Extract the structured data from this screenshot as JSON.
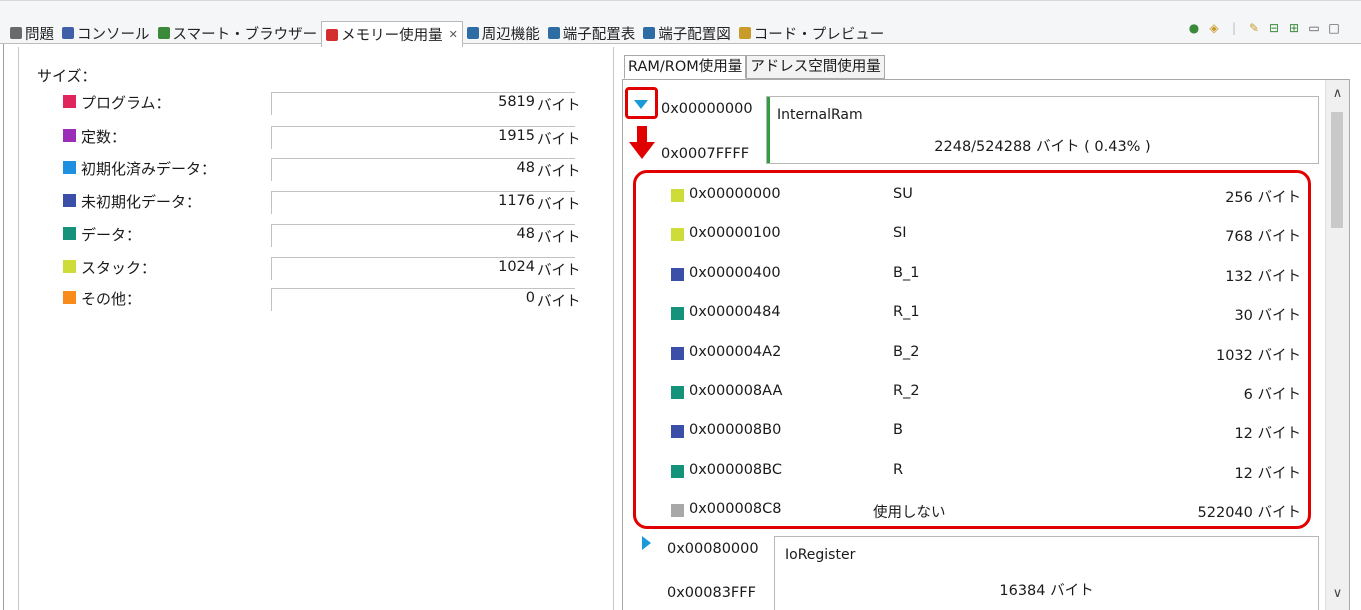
{
  "tabs": [
    {
      "label": "問題",
      "icon": "problems-icon",
      "color": "#6a6a6a"
    },
    {
      "label": "コンソール",
      "icon": "console-icon",
      "color": "#3f5fa8"
    },
    {
      "label": "スマート・ブラウザー",
      "icon": "smart-browser-icon",
      "color": "#3a8a3a"
    },
    {
      "label": "メモリー使用量",
      "icon": "memory-usage-icon",
      "color": "#d32f2f",
      "active": true,
      "close": "✕"
    },
    {
      "label": "周辺機能",
      "icon": "peripheral-icon",
      "color": "#2e6da4"
    },
    {
      "label": "端子配置表",
      "icon": "pin-table-icon",
      "color": "#2e6da4"
    },
    {
      "label": "端子配置図",
      "icon": "pin-diagram-icon",
      "color": "#2e6da4"
    },
    {
      "label": "コード・プレビュー",
      "icon": "code-preview-icon",
      "color": "#c89b2b"
    }
  ],
  "toolbar": {
    "minimize": "▭",
    "maximize": "□"
  },
  "left": {
    "title": "サイズ：",
    "items": [
      {
        "label": "プログラム：",
        "value": "5819",
        "unit": "バイト",
        "color": "#e0255c"
      },
      {
        "label": "定数：",
        "value": "1915",
        "unit": "バイト",
        "color": "#9b2db6"
      },
      {
        "label": "初期化済みデータ：",
        "value": "48",
        "unit": "バイト",
        "color": "#1f8fe0"
      },
      {
        "label": "未初期化データ：",
        "value": "1176",
        "unit": "バイト",
        "color": "#3b4fa8"
      },
      {
        "label": "データ：",
        "value": "48",
        "unit": "バイト",
        "color": "#14927a"
      },
      {
        "label": "スタック：",
        "value": "1024",
        "unit": "バイト",
        "color": "#cddc39"
      },
      {
        "label": "その他：",
        "value": "0",
        "unit": "バイト",
        "color": "#f78c1a"
      }
    ]
  },
  "right": {
    "tabs": [
      {
        "label": "RAM/ROM使用量",
        "active": true
      },
      {
        "label": "アドレス空間使用量",
        "active": false
      }
    ],
    "regions": [
      {
        "start": "0x00000000",
        "end": "0x0007FFFF",
        "name": "InternalRam",
        "usage": "2248/524288 バイト ( 0.43% )",
        "expanded": true
      },
      {
        "start": "0x00080000",
        "end": "0x00083FFF",
        "name": "IoRegister",
        "usage": "16384 バイト",
        "expanded": false
      }
    ],
    "segments": [
      {
        "addr": "0x00000000",
        "name": "SU",
        "size": "256 バイト",
        "color": "#cddc39"
      },
      {
        "addr": "0x00000100",
        "name": "SI",
        "size": "768 バイト",
        "color": "#cddc39"
      },
      {
        "addr": "0x00000400",
        "name": "B_1",
        "size": "132 バイト",
        "color": "#3b4fa8"
      },
      {
        "addr": "0x00000484",
        "name": "R_1",
        "size": "30 バイト",
        "color": "#14927a"
      },
      {
        "addr": "0x000004A2",
        "name": "B_2",
        "size": "1032 バイト",
        "color": "#3b4fa8"
      },
      {
        "addr": "0x000008AA",
        "name": "R_2",
        "size": "6 バイト",
        "color": "#14927a"
      },
      {
        "addr": "0x000008B0",
        "name": "B",
        "size": "12 バイト",
        "color": "#3b4fa8"
      },
      {
        "addr": "0x000008BC",
        "name": "R",
        "size": "12 バイト",
        "color": "#14927a"
      },
      {
        "addr": "0x000008C8",
        "name": "使用しない",
        "size": "522040 バイト",
        "color": "#a8a8a8"
      }
    ],
    "scroll_up": "∧",
    "scroll_down": "∨"
  },
  "colors": {
    "highlight": "#e00000",
    "expand_triangle": "#1a9ad7",
    "region_bar": "#2e9e3e"
  }
}
